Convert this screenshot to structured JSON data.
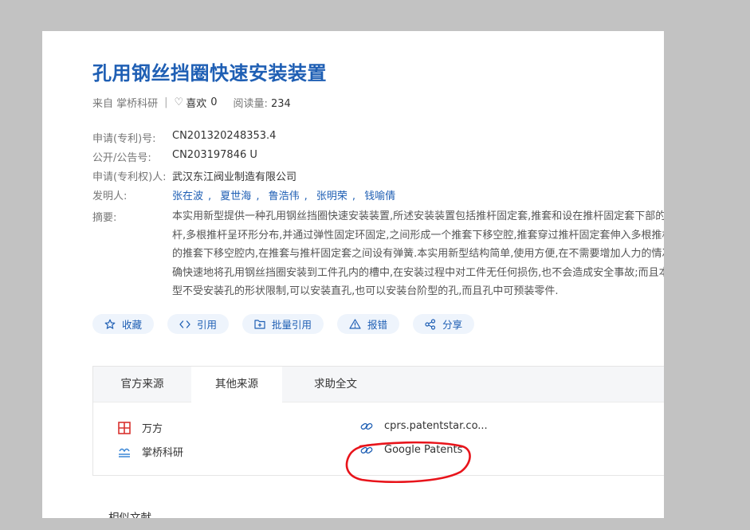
{
  "title": "孔用钢丝挡圈快速安装装置",
  "meta": {
    "source": "来自 掌桥科研",
    "likes_label": "喜欢",
    "likes": "0",
    "reads_label": "阅读量:",
    "reads": "234"
  },
  "fields": {
    "app_no_label": "申请(专利)号:",
    "app_no": "CN201320248353.4",
    "pub_no_label": "公开/公告号:",
    "pub_no": "CN203197846 U",
    "applicant_label": "申请(专利权)人:",
    "applicant": "武汉东江阀业制造有限公司",
    "inventors_label": "发明人:",
    "inventors": [
      "张在波",
      "夏世海",
      "鲁浩伟",
      "张明荣",
      "钱喻倩"
    ],
    "abstract_label": "摘要:"
  },
  "abstract_lines": [
    "本实用新型提供一种孔用钢丝挡圈快速安装装置,所述安装装置包括推杆固定套,推套和设在推杆固定套下部的",
    "杆,多根推杆呈环形分布,并通过弹性固定环固定,之间形成一个推套下移空腔,推套穿过推杆固定套伸入多根推杆",
    "的推套下移空腔内,在推套与推杆固定套之间设有弹簧.本实用新型结构简单,使用方便,在不需要增加人力的情况",
    "确快速地将孔用钢丝挡圈安装到工件孔内的槽中,在安装过程中对工件无任何损伤,也不会造成安全事故;而且本",
    "型不受安装孔的形状限制,可以安装直孔,也可以安装台阶型的孔,而且孔中可预装零件."
  ],
  "actions": {
    "favorite": "收藏",
    "cite": "引用",
    "batch_cite": "批量引用",
    "report": "报错",
    "share": "分享"
  },
  "tabs": {
    "official": "官方来源",
    "other": "其他来源",
    "request": "求助全文"
  },
  "sources": {
    "wanfang": "万方",
    "zhangqiao": "掌桥科研",
    "patentstar": "cprs.patentstar.co...",
    "google": "Google Patents"
  },
  "similar_heading": "相似文献",
  "colors": {
    "accent": "#1f5fb4",
    "annotation": "#e8141b",
    "wanfang": "#d9322f"
  }
}
